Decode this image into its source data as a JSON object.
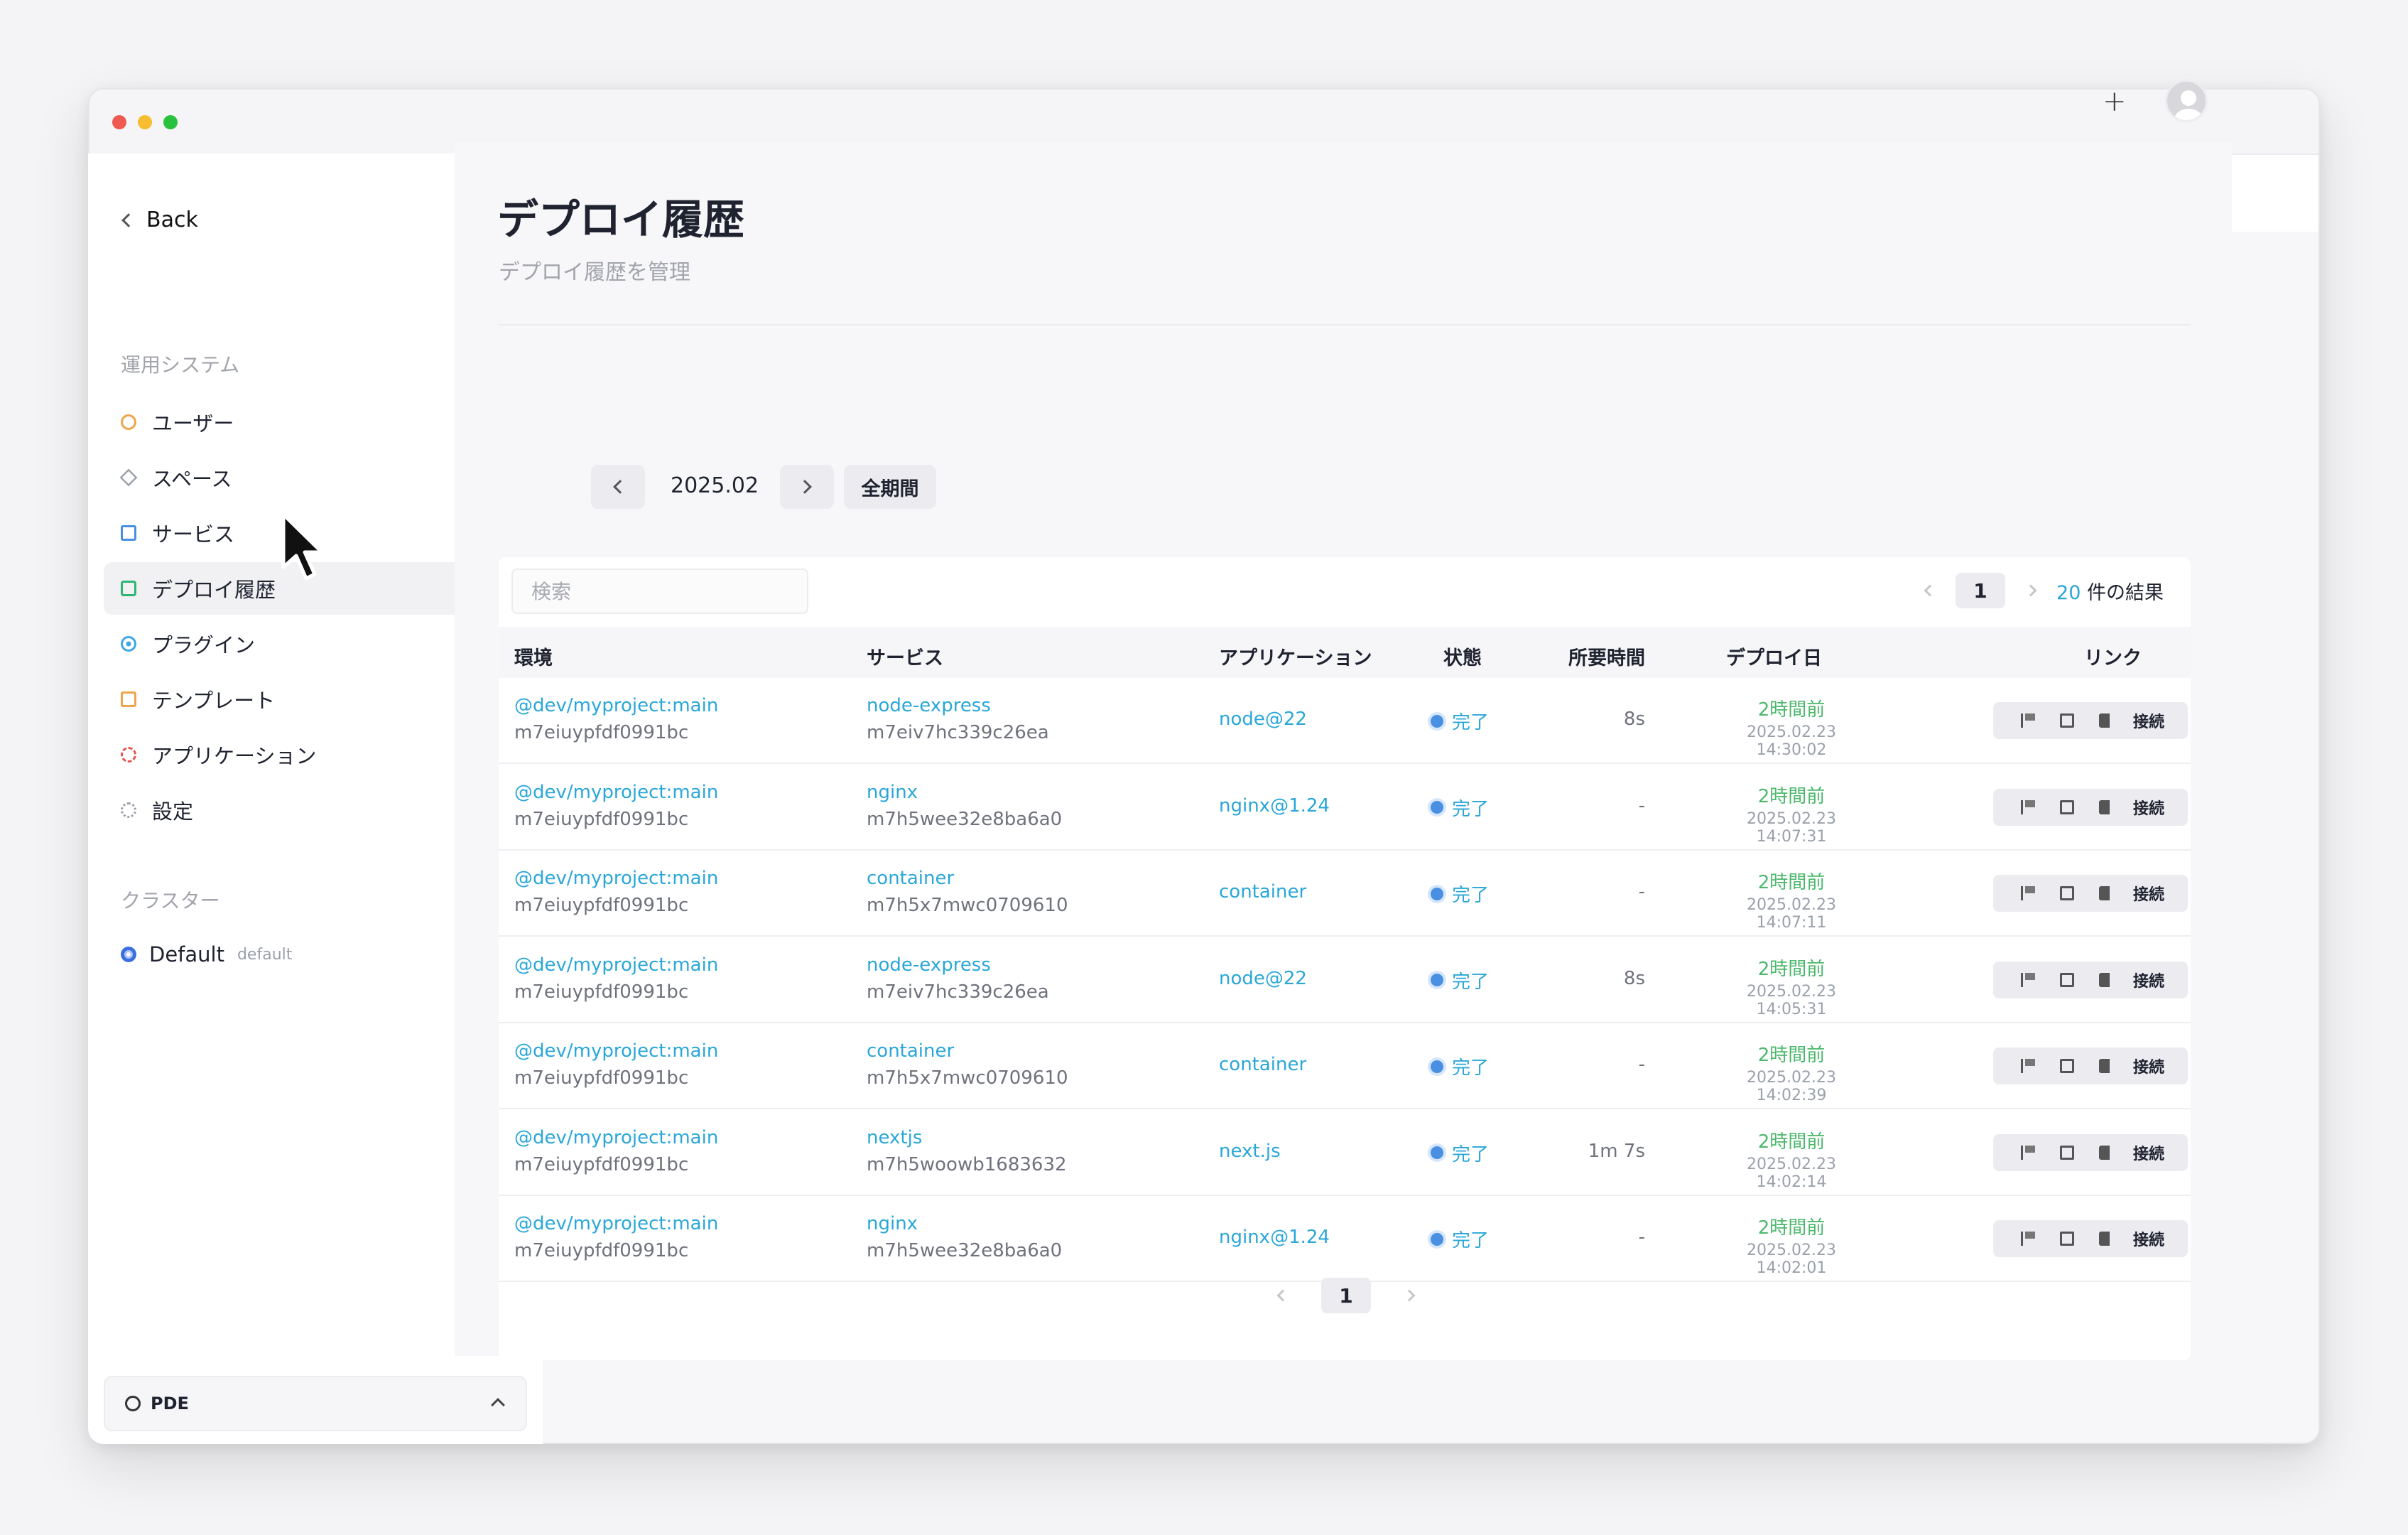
{
  "app": {
    "back_label": "Back"
  },
  "sidebar": {
    "section_title": "運用システム",
    "items": [
      {
        "label": "ユーザー",
        "icon": "users-icon"
      },
      {
        "label": "スペース",
        "icon": "layers-icon"
      },
      {
        "label": "サービス",
        "icon": "window-icon"
      },
      {
        "label": "デプロイ履歴",
        "icon": "package-icon",
        "active": true
      },
      {
        "label": "プラグイン",
        "icon": "plugin-icon"
      },
      {
        "label": "テンプレート",
        "icon": "template-icon"
      },
      {
        "label": "アプリケーション",
        "icon": "app-icon"
      },
      {
        "label": "設定",
        "icon": "settings-icon"
      }
    ],
    "cluster_title": "クラスター",
    "cluster": {
      "name": "Default",
      "tag": "default"
    },
    "workspace": {
      "label": "PDE"
    }
  },
  "header": {
    "plus_label": "+"
  },
  "page": {
    "title": "デプロイ履歴",
    "subtitle": "デプロイ履歴を管理"
  },
  "filter": {
    "period": "2025.02",
    "all_label": "全期間"
  },
  "table": {
    "search_placeholder": "検索",
    "current_page": "1",
    "result_count": "20",
    "result_suffix": "件の結果",
    "headers": [
      "環境",
      "サービス",
      "アプリケーション",
      "状態",
      "所要時間",
      "デプロイ日",
      "リンク"
    ],
    "connect_label": "接続",
    "rows": [
      {
        "env": "@dev/myproject:main",
        "env_id": "m7eiuypfdf0991bc",
        "service": "node-express",
        "service_id": "m7eiv7hc339c26ea",
        "app": "node@22",
        "status": "完了",
        "duration": "8s",
        "ago": "2時間前",
        "date": "2025.02.23 14:30:02"
      },
      {
        "env": "@dev/myproject:main",
        "env_id": "m7eiuypfdf0991bc",
        "service": "nginx",
        "service_id": "m7h5wee32e8ba6a0",
        "app": "nginx@1.24",
        "status": "完了",
        "duration": "-",
        "ago": "2時間前",
        "date": "2025.02.23 14:07:31"
      },
      {
        "env": "@dev/myproject:main",
        "env_id": "m7eiuypfdf0991bc",
        "service": "container",
        "service_id": "m7h5x7mwc0709610",
        "app": "container",
        "status": "完了",
        "duration": "-",
        "ago": "2時間前",
        "date": "2025.02.23 14:07:11"
      },
      {
        "env": "@dev/myproject:main",
        "env_id": "m7eiuypfdf0991bc",
        "service": "node-express",
        "service_id": "m7eiv7hc339c26ea",
        "app": "node@22",
        "status": "完了",
        "duration": "8s",
        "ago": "2時間前",
        "date": "2025.02.23 14:05:31"
      },
      {
        "env": "@dev/myproject:main",
        "env_id": "m7eiuypfdf0991bc",
        "service": "container",
        "service_id": "m7h5x7mwc0709610",
        "app": "container",
        "status": "完了",
        "duration": "-",
        "ago": "2時間前",
        "date": "2025.02.23 14:02:39"
      },
      {
        "env": "@dev/myproject:main",
        "env_id": "m7eiuypfdf0991bc",
        "service": "nextjs",
        "service_id": "m7h5woowb1683632",
        "app": "next.js",
        "status": "完了",
        "duration": "1m 7s",
        "ago": "2時間前",
        "date": "2025.02.23 14:02:14"
      },
      {
        "env": "@dev/myproject:main",
        "env_id": "m7eiuypfdf0991bc",
        "service": "nginx",
        "service_id": "m7h5wee32e8ba6a0",
        "app": "nginx@1.24",
        "status": "完了",
        "duration": "-",
        "ago": "2時間前",
        "date": "2025.02.23 14:02:01"
      }
    ]
  },
  "colors": {
    "accent": "#2aa7d8",
    "success": "#4cb86c",
    "status_dot": "#4a90e2"
  }
}
